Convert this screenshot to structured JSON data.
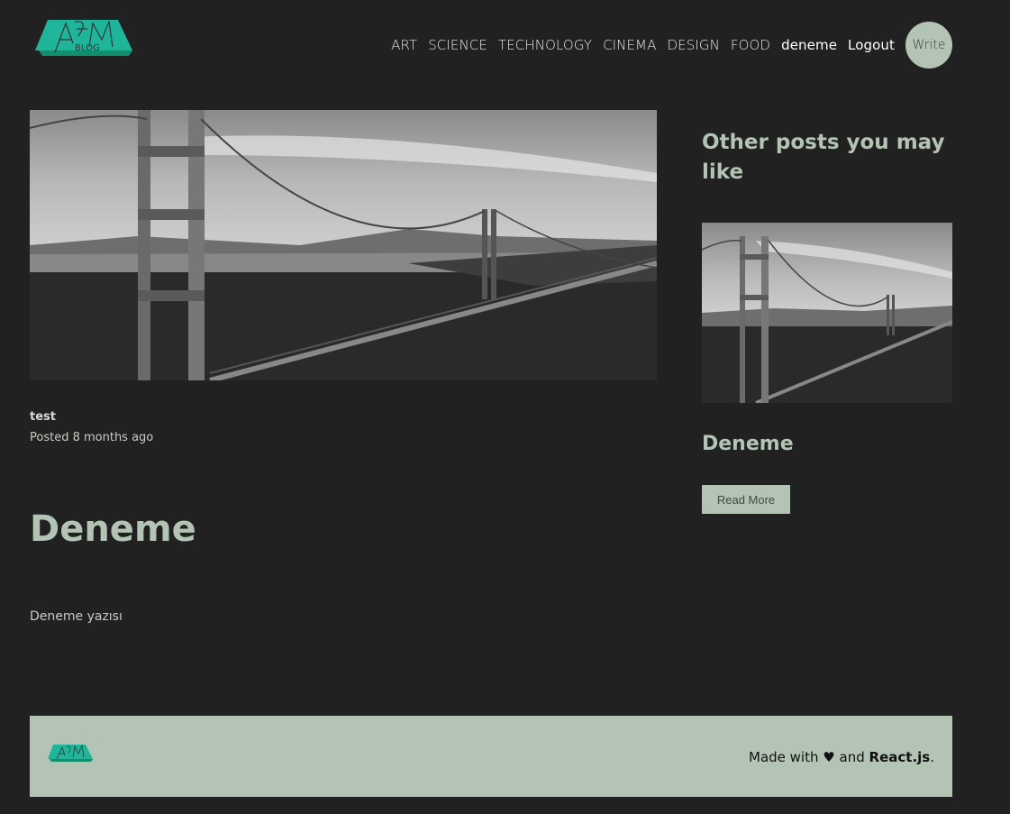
{
  "logo": {
    "text": "AFM",
    "subtext": "BLOG",
    "color": "#1fb59a"
  },
  "nav": {
    "categories": [
      "ART",
      "SCIENCE",
      "TECHNOLOGY",
      "CINEMA",
      "DESIGN",
      "FOOD"
    ],
    "username": "deneme",
    "logout_label": "Logout",
    "write_label": "Write"
  },
  "post": {
    "user": "test",
    "date": "Posted 8 months ago",
    "title": "Deneme",
    "body": "Deneme yazısı"
  },
  "sidebar": {
    "heading": "Other posts you may like",
    "posts": [
      {
        "title": "Deneme",
        "button_label": "Read More"
      }
    ]
  },
  "footer": {
    "made_with": "Made with",
    "heart": "♥",
    "and": "and",
    "tech": "React.js",
    "period": "."
  },
  "colors": {
    "background": "#212121",
    "accent": "#b3c4b4",
    "logo": "#1fb59a"
  }
}
